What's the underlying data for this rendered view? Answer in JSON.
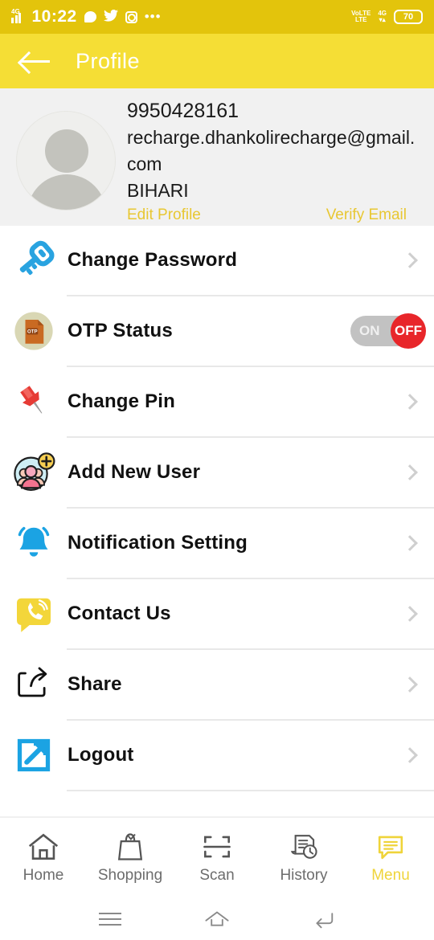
{
  "status_bar": {
    "network_label": "4G",
    "time": "10:22",
    "overflow": "•••",
    "volte_top": "VoLTE",
    "volte_bottom": "LTE",
    "data_label": "4G",
    "battery_percent": "70",
    "icons": [
      "signal-4g-icon",
      "chat-bubble-icon",
      "twitter-icon",
      "instagram-icon",
      "overflow-dots-icon"
    ]
  },
  "app_bar": {
    "title": "Profile",
    "back_icon": "back-arrow-icon",
    "background": "#f5de35"
  },
  "profile": {
    "avatar_icon": "default-avatar-icon",
    "phone": "9950428161",
    "email": "recharge.dhankolirecharge@gmail.com",
    "region": "BIHARI",
    "edit_link": "Edit Profile",
    "verify_link": "Verify Email",
    "link_color": "#e8c732",
    "card_background": "#f1f1f1"
  },
  "menu": {
    "items": [
      {
        "label": "Change Password",
        "icon": "key-icon",
        "control": "chevron"
      },
      {
        "label": "OTP Status",
        "icon": "otp-document-icon",
        "control": "toggle"
      },
      {
        "label": "Change Pin",
        "icon": "pushpin-icon",
        "control": "chevron"
      },
      {
        "label": "Add New User",
        "icon": "add-user-group-icon",
        "control": "chevron"
      },
      {
        "label": "Notification Setting",
        "icon": "bell-icon",
        "control": "chevron"
      },
      {
        "label": "Contact Us",
        "icon": "call-bubble-icon",
        "control": "chevron"
      },
      {
        "label": "Share",
        "icon": "share-icon",
        "control": "chevron"
      },
      {
        "label": "Logout",
        "icon": "logout-external-link-icon",
        "control": "chevron"
      }
    ]
  },
  "otp_toggle": {
    "on_label": "ON",
    "off_label": "OFF",
    "state": "OFF",
    "track_color": "#c2c2c2",
    "knob_color": "#e8262a"
  },
  "bottom_nav": {
    "active_color": "#efd43a",
    "inactive_color": "#6d6d6d",
    "items": [
      {
        "label": "Home",
        "icon": "home-icon",
        "active": false
      },
      {
        "label": "Shopping",
        "icon": "shopping-bag-icon",
        "active": false
      },
      {
        "label": "Scan",
        "icon": "scan-frame-icon",
        "active": false
      },
      {
        "label": "History",
        "icon": "history-clock-icon",
        "active": false
      },
      {
        "label": "Menu",
        "icon": "menu-chat-icon",
        "active": true
      }
    ]
  },
  "android_nav": {
    "items": [
      {
        "icon": "recents-icon"
      },
      {
        "icon": "home-outline-icon"
      },
      {
        "icon": "back-return-icon"
      }
    ]
  }
}
